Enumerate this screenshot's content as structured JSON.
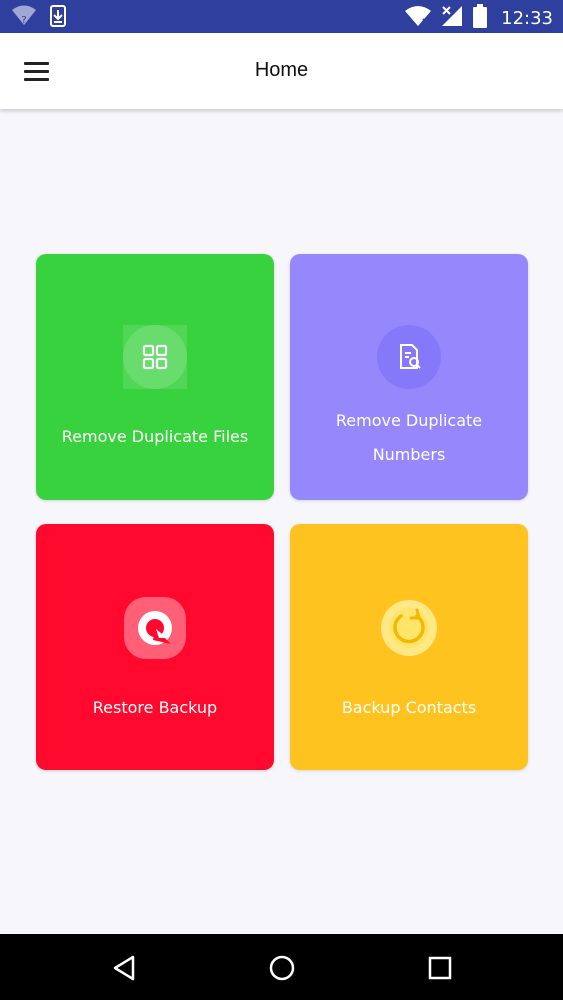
{
  "status_bar": {
    "time": "12:33",
    "icons": [
      "wifi-unknown-icon",
      "download-icon",
      "wifi-icon",
      "signal-icon",
      "battery-icon"
    ]
  },
  "app_bar": {
    "title": "Home",
    "menu_icon": "hamburger-menu-icon"
  },
  "cards": [
    {
      "label": "Remove Duplicate Files",
      "color": "#38d23e",
      "icon": "grid-icon"
    },
    {
      "label": "Remove Duplicate Numbers",
      "color": "#9488fc",
      "icon": "document-search-icon"
    },
    {
      "label": "Restore Backup",
      "color": "#ff0a2e",
      "icon": "restore-icon"
    },
    {
      "label": "Backup Contacts",
      "color": "#ffc31f",
      "icon": "backup-sync-icon"
    }
  ],
  "nav_bar": {
    "buttons": [
      "back-icon",
      "home-icon",
      "recents-icon"
    ]
  },
  "colors": {
    "status_bar": "#2f3f9e",
    "background": "#f7f6fa"
  }
}
